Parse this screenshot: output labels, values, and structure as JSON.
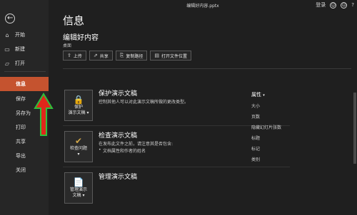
{
  "window": {
    "doc_title": "编辑好内容.pptx",
    "login": "登录",
    "help": "?",
    "smile": "☺",
    "frown": "☹"
  },
  "sidebar": {
    "back": "←",
    "items": [
      {
        "icon": "⌂",
        "label": "开始"
      },
      {
        "icon": "▭",
        "label": "新建"
      },
      {
        "icon": "▱",
        "label": "打开"
      },
      {
        "label": "信息"
      },
      {
        "label": "保存"
      },
      {
        "label": "另存为"
      },
      {
        "label": "打印"
      },
      {
        "label": "共享"
      },
      {
        "label": "导出"
      },
      {
        "label": "关闭"
      }
    ]
  },
  "main": {
    "title": "信息",
    "section_title": "编辑好内容",
    "section_sub": "桌面",
    "actions": [
      {
        "icon": "⇪",
        "label": "上传"
      },
      {
        "icon": "⇗",
        "label": "共享"
      },
      {
        "icon": "⎘",
        "label": "复制路径"
      },
      {
        "icon": "▤",
        "label": "打开文件位置"
      }
    ]
  },
  "cards": [
    {
      "icon_label_1": "保护",
      "icon_label_2": "演示文稿 ▾",
      "glyph": "🔒",
      "title": "保护演示文稿",
      "desc": "控制其他人可以对此演示文稿所做的更改类型。"
    },
    {
      "icon_label_1": "检查问题",
      "icon_label_2": "▾",
      "glyph": "✔",
      "title": "检查演示文稿",
      "desc": "在发布此文件之前，请注意其是否包含:",
      "bullet": "文档属性和作者的姓名"
    },
    {
      "icon_label_1": "管理演示",
      "icon_label_2": "文稿 ▾",
      "glyph": "📄",
      "title": "管理演示文稿"
    }
  ],
  "properties": {
    "header": "属性",
    "header_arrow": "▾",
    "items": [
      "大小",
      "页数",
      "隐藏幻灯片张数",
      "标题",
      "标记",
      "类别"
    ]
  },
  "colors": {
    "accent": "#c5532f",
    "background": "#1f1f1f",
    "sidebar": "#262626",
    "arrow_fill": "#e0261b",
    "arrow_stroke": "#2fbf3a"
  }
}
